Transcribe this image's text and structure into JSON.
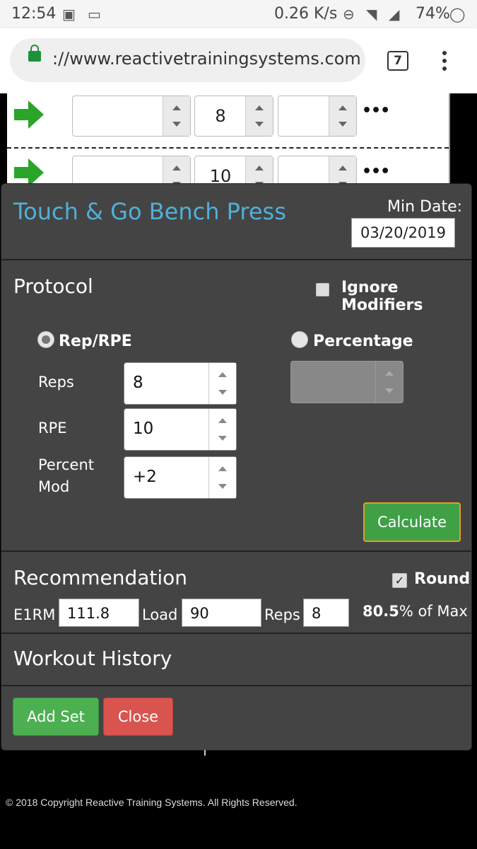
{
  "status_bar": {
    "time": "12:54",
    "net_speed": "0.26 K/s",
    "battery": "74%"
  },
  "browser": {
    "url": "://www.reactivetrainingsystems.com",
    "tab_count": "7"
  },
  "background_rows": [
    {
      "reps": "8"
    },
    {
      "reps": "10"
    }
  ],
  "modal": {
    "title": "Touch & Go Bench Press",
    "min_date_label": "Min Date:",
    "min_date": "03/20/2019",
    "protocol": {
      "heading": "Protocol",
      "ignore_modifiers": "Ignore Modifiers",
      "rep_rpe_label": "Rep/RPE",
      "percentage_label": "Percentage",
      "reps_label": "Reps",
      "reps_value": "8",
      "rpe_label": "RPE",
      "rpe_value": "10",
      "percent_mod_label_1": "Percent",
      "percent_mod_label_2": "Mod",
      "percent_mod_value": "+2",
      "calculate": "Calculate"
    },
    "recommendation": {
      "heading": "Recommendation",
      "round_label": "Round",
      "e1rm_label": "E1RM",
      "e1rm_value": "111.8",
      "load_label": "Load",
      "load_value": "90",
      "reps_label": "Reps",
      "reps_value": "8",
      "percent_value": "80.5",
      "percent_suffix": "% of Max"
    },
    "workout_history": "Workout History",
    "add_set": "Add Set",
    "close": "Close"
  },
  "footer": "© 2018 Copyright Reactive Training Systems. All Rights Reserved."
}
